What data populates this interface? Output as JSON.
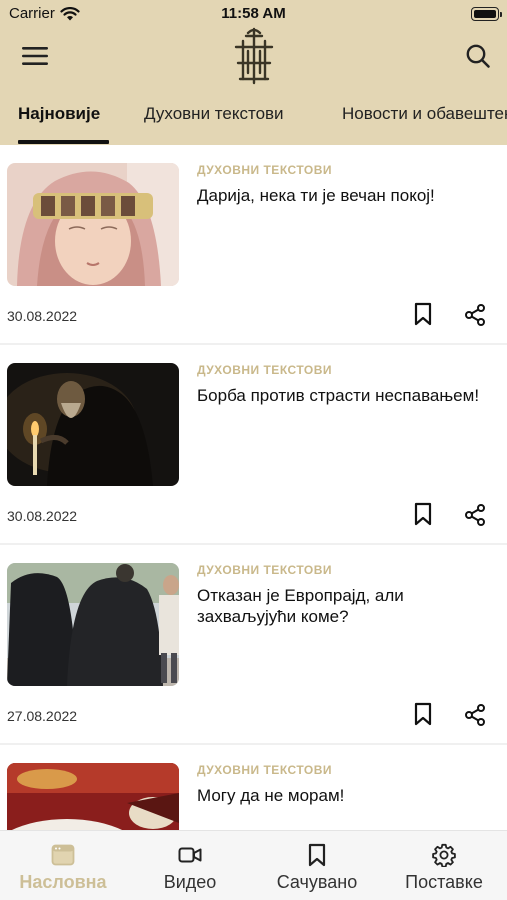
{
  "status_bar": {
    "carrier": "Carrier",
    "time": "11:58 AM"
  },
  "header": {
    "icons": {
      "menu": "hamburger-menu-icon",
      "logo": "church-cross-logo",
      "search": "search-icon"
    },
    "colors": {
      "background": "#e3d6b4",
      "accent": "#c9b88a"
    }
  },
  "tabs": [
    {
      "label": "Најновије",
      "active": true
    },
    {
      "label": "Духовни текстови",
      "active": false
    },
    {
      "label": "Новости и обавештења",
      "active": false
    }
  ],
  "articles": [
    {
      "category": "ДУХОВНИ ТЕКСТОВИ",
      "title": "Дарија, нека ти је вечан покој!",
      "date": "30.08.2022"
    },
    {
      "category": "ДУХОВНИ ТЕКСТОВИ",
      "title": "Борба против страсти неспавањем!",
      "date": "30.08.2022"
    },
    {
      "category": "ДУХОВНИ ТЕКСТОВИ",
      "title": "Отказан је Европрајд, али захваљујући коме?",
      "date": "27.08.2022"
    },
    {
      "category": "ДУХОВНИ ТЕКСТОВИ",
      "title": "Могу да не морам!",
      "date": ""
    }
  ],
  "tabbar": [
    {
      "label": "Насловна",
      "icon": "home-icon",
      "active": true
    },
    {
      "label": "Видео",
      "icon": "video-camera-icon",
      "active": false
    },
    {
      "label": "Сачувано",
      "icon": "bookmark-icon",
      "active": false
    },
    {
      "label": "Поставке",
      "icon": "gear-icon",
      "active": false
    }
  ]
}
